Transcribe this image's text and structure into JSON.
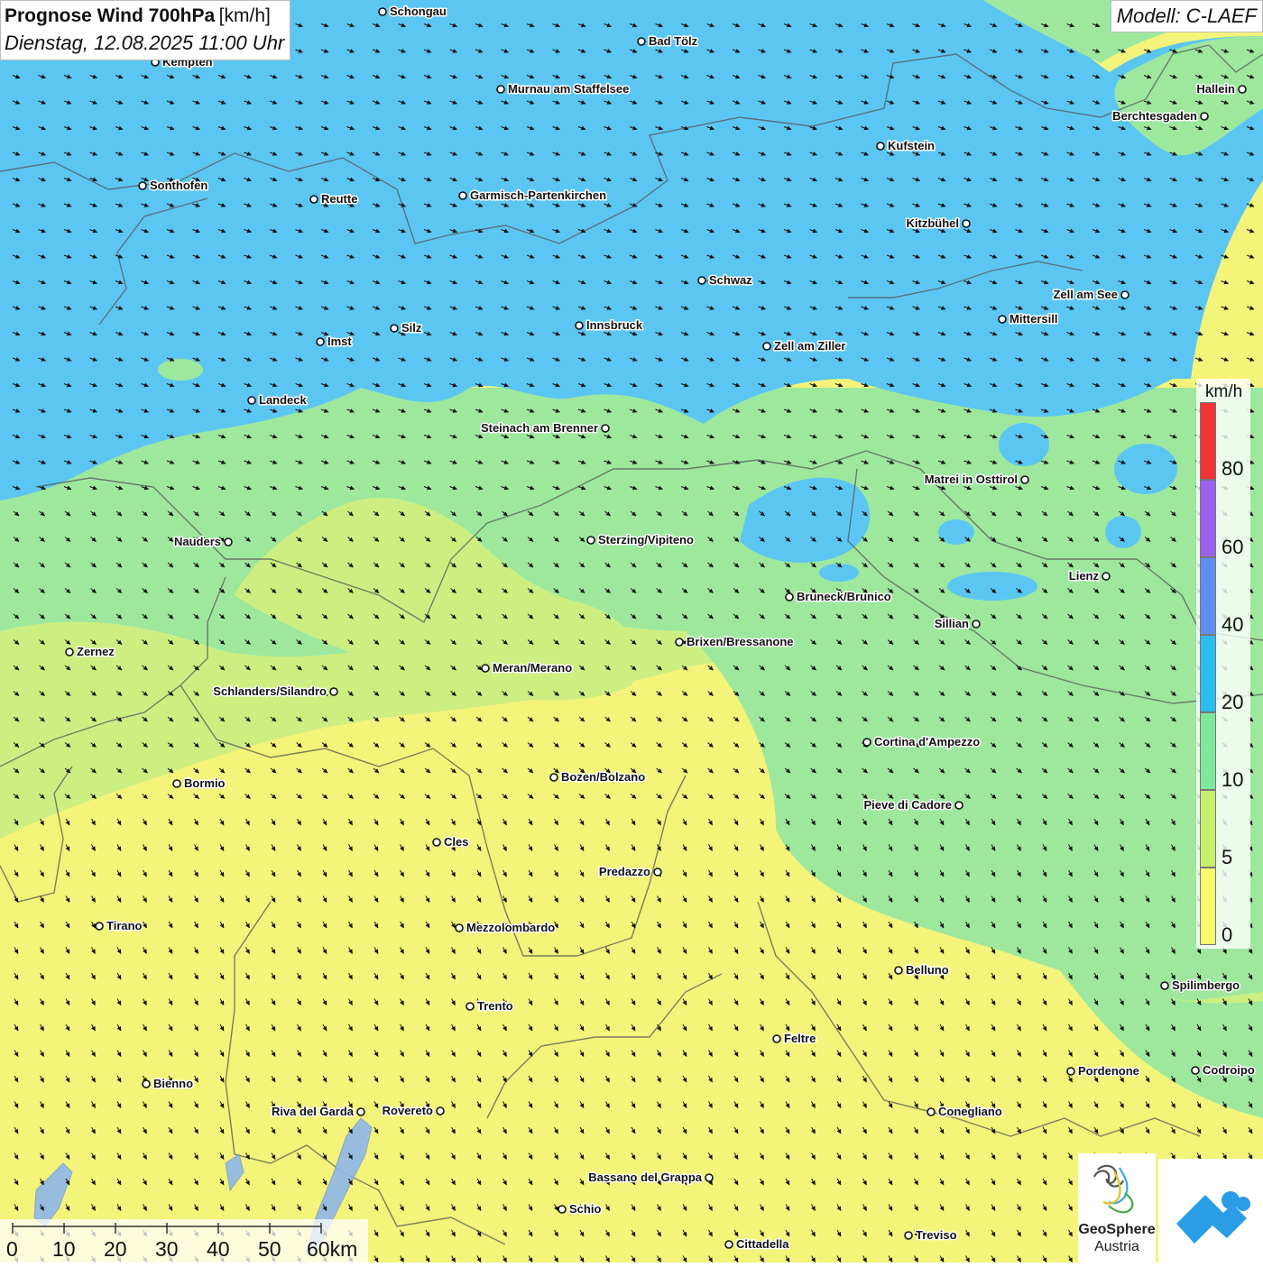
{
  "title": {
    "main": "Prognose Wind 700hPa",
    "unit": "[km/h]",
    "datetime": "Dienstag, 12.08.2025 11:00 Uhr"
  },
  "model": "Modell: C-LAEF",
  "legend": {
    "unit": "km/h",
    "labels": [
      "80",
      "60",
      "40",
      "20",
      "10",
      "5",
      "0"
    ],
    "colors": [
      "#f03434",
      "#9a62ec",
      "#5e8ff0",
      "#2bbcf0",
      "#7ce89a",
      "#c6f06e",
      "#fafa6e"
    ]
  },
  "scale_bar": {
    "labels": [
      "0",
      "10",
      "20",
      "30",
      "40",
      "50",
      "60km"
    ]
  },
  "cities": [
    {
      "name": "Schongau"
    },
    {
      "name": "Bad Tölz"
    },
    {
      "name": "Kempten"
    },
    {
      "name": "Murnau am Staffelsee"
    },
    {
      "name": "Hallein"
    },
    {
      "name": "Berchtesgaden"
    },
    {
      "name": "Kufstein"
    },
    {
      "name": "Sonthofen"
    },
    {
      "name": "Reutte"
    },
    {
      "name": "Garmisch-Partenkirchen"
    },
    {
      "name": "Kitzbühel"
    },
    {
      "name": "Schwaz"
    },
    {
      "name": "Zell am See"
    },
    {
      "name": "Innsbruck"
    },
    {
      "name": "Silz"
    },
    {
      "name": "Mittersill"
    },
    {
      "name": "Imst"
    },
    {
      "name": "Zell am Ziller"
    },
    {
      "name": "Landeck"
    },
    {
      "name": "Steinach am Brenner"
    },
    {
      "name": "Matrei in Osttirol"
    },
    {
      "name": "Nauders"
    },
    {
      "name": "Sterzing/Vipiteno"
    },
    {
      "name": "Lienz"
    },
    {
      "name": "Bruneck/Brunico"
    },
    {
      "name": "Sillian"
    },
    {
      "name": "Zernez"
    },
    {
      "name": "Brixen/Bressanone"
    },
    {
      "name": "Meran/Merano"
    },
    {
      "name": "Schlanders/Silandro"
    },
    {
      "name": "Cortina d'Ampezzo"
    },
    {
      "name": "Bozen/Bolzano"
    },
    {
      "name": "Bormio"
    },
    {
      "name": "Pieve di Cadore"
    },
    {
      "name": "Cles"
    },
    {
      "name": "Predazzo"
    },
    {
      "name": "Tirano"
    },
    {
      "name": "Mezzolombardo"
    },
    {
      "name": "Belluno"
    },
    {
      "name": "Spilimbergo"
    },
    {
      "name": "Trento"
    },
    {
      "name": "Feltre"
    },
    {
      "name": "Pordenone"
    },
    {
      "name": "Codroipo"
    },
    {
      "name": "Bienno"
    },
    {
      "name": "Riva del Garda"
    },
    {
      "name": "Rovereto"
    },
    {
      "name": "Conegliano"
    },
    {
      "name": "Bassano del Grappa"
    },
    {
      "name": "Schio"
    },
    {
      "name": "Treviso"
    },
    {
      "name": "Cittadella"
    }
  ],
  "logos": {
    "geosphere_line1": "GeoSphere",
    "geosphere_line2": "Austria"
  }
}
